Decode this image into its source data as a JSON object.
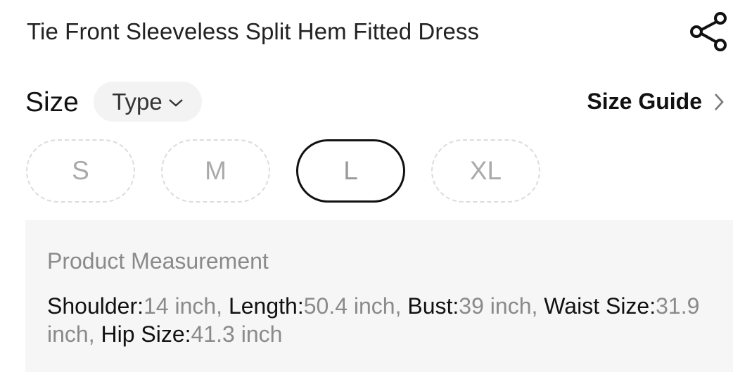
{
  "product": {
    "title": "Tie Front Sleeveless Split Hem Fitted Dress"
  },
  "size_section": {
    "label": "Size",
    "type_label": "Type",
    "guide_label": "Size Guide",
    "options": [
      {
        "label": "S",
        "state": "unavailable"
      },
      {
        "label": "M",
        "state": "unavailable"
      },
      {
        "label": "L",
        "state": "selected"
      },
      {
        "label": "XL",
        "state": "unavailable"
      }
    ]
  },
  "measurement": {
    "heading": "Product Measurement",
    "items": [
      {
        "name": "Shoulder:",
        "value": "14 inch",
        "sep": ", "
      },
      {
        "name": "Length:",
        "value": "50.4 inch",
        "sep": ", "
      },
      {
        "name": "Bust:",
        "value": "39 inch",
        "sep": ", "
      },
      {
        "name": "Waist Size:",
        "value": "31.9 inch",
        "sep": ", "
      },
      {
        "name": "Hip Size:",
        "value": "41.3 inch",
        "sep": ""
      }
    ]
  },
  "icons": {
    "share": "share-icon",
    "type_dropdown": "chevron-down-icon",
    "guide_arrow": "chevron-right-icon"
  },
  "colors": {
    "text": "#111111",
    "muted": "#8a8a8a",
    "panel_bg": "#f6f6f6",
    "pill_bg": "#f3f3f3"
  }
}
